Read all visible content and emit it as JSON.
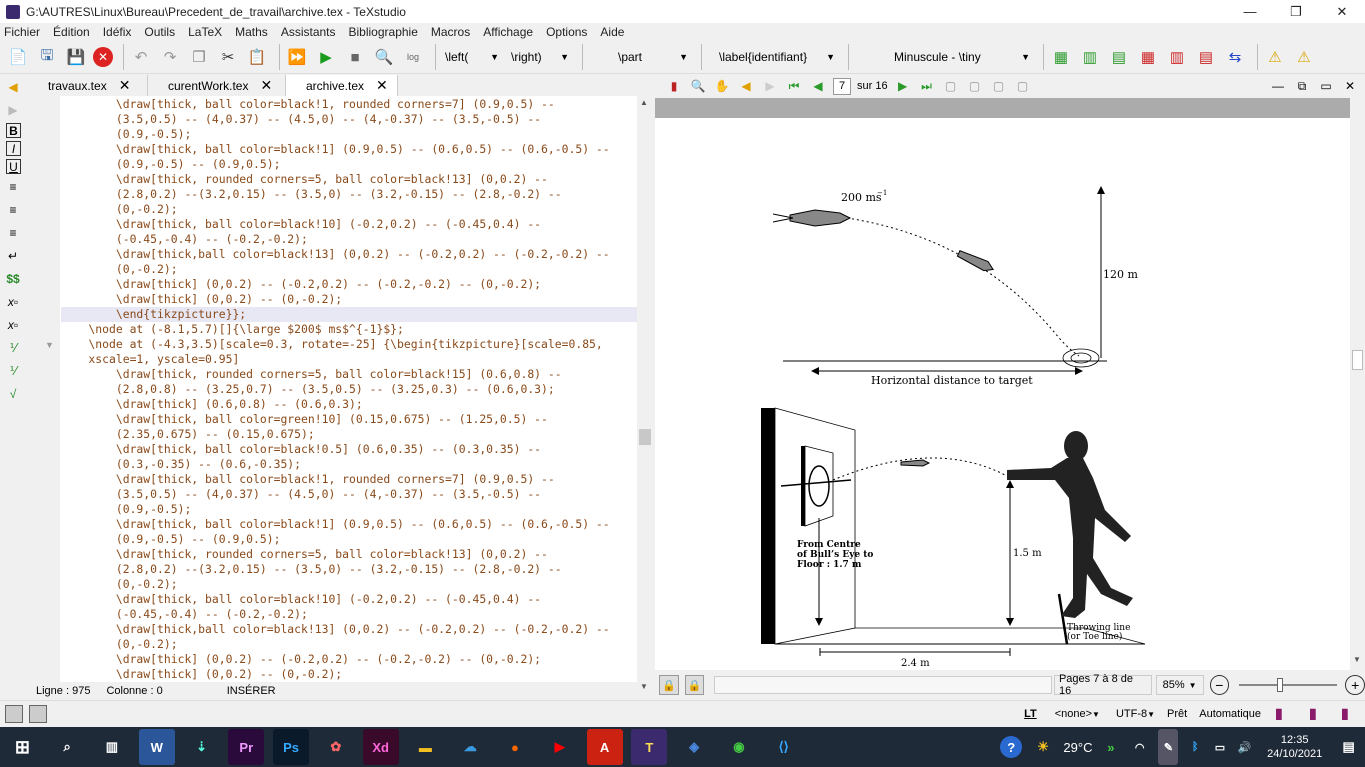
{
  "window": {
    "title": "G:\\AUTRES\\Linux\\Bureau\\Precedent_de_travail\\archive.tex - TeXstudio",
    "min": "—",
    "max": "❐",
    "close": "✕"
  },
  "menu": [
    "Fichier",
    "Édition",
    "Idéfix",
    "Outils",
    "LaTeX",
    "Maths",
    "Assistants",
    "Bibliographie",
    "Macros",
    "Affichage",
    "Options",
    "Aide"
  ],
  "toolbar": {
    "left_combo": "\\left(",
    "right_combo": "\\right)",
    "part_combo": "\\part",
    "label_combo": "\\label{identifiant}",
    "size_combo": "Minuscule - \\tiny"
  },
  "tabs": [
    {
      "label": "travaux.tex",
      "close": "✕"
    },
    {
      "label": "curentWork.tex",
      "close": "✕"
    },
    {
      "label": "archive.tex",
      "close": "✕"
    }
  ],
  "editor": {
    "lines": [
      "        \\draw[thick, ball color=black!1, rounded corners=7] (0.9,0.5) --",
      "        (3.5,0.5) -- (4,0.37) -- (4.5,0) -- (4,-0.37) -- (3.5,-0.5) --",
      "        (0.9,-0.5);",
      "        \\draw[thick, ball color=black!1] (0.9,0.5) -- (0.6,0.5) -- (0.6,-0.5) --",
      "        (0.9,-0.5) -- (0.9,0.5);",
      "        \\draw[thick, rounded corners=5, ball color=black!13] (0,0.2) --",
      "        (2.8,0.2) --(3.2,0.15) -- (3.5,0) -- (3.2,-0.15) -- (2.8,-0.2) --",
      "        (0,-0.2);",
      "        \\draw[thick, ball color=black!10] (-0.2,0.2) -- (-0.45,0.4) --",
      "        (-0.45,-0.4) -- (-0.2,-0.2);",
      "        \\draw[thick,ball color=black!13] (0,0.2) -- (-0.2,0.2) -- (-0.2,-0.2) --",
      "        (0,-0.2);",
      "        \\draw[thick] (0,0.2) -- (-0.2,0.2) -- (-0.2,-0.2) -- (0,-0.2);",
      "        \\draw[thick] (0,0.2) -- (0,-0.2);",
      "        \\end{tikzpicture}};",
      "    \\node at (-8.1,5.7)[]{\\large $200$ ms$^{-1}$};",
      "    \\node at (-4.3,3.5)[scale=0.3, rotate=-25] {\\begin{tikzpicture}[scale=0.85,",
      "    xscale=1, yscale=0.95]",
      "        \\draw[thick, rounded corners=5, ball color=black!15] (0.6,0.8) --",
      "        (2.8,0.8) -- (3.25,0.7) -- (3.5,0.5) -- (3.25,0.3) -- (0.6,0.3);",
      "        \\draw[thick] (0.6,0.8) -- (0.6,0.3);",
      "        \\draw[thick, ball color=green!10] (0.15,0.675) -- (1.25,0.5) --",
      "        (2.35,0.675) -- (0.15,0.675);",
      "        \\draw[thick, ball color=black!0.5] (0.6,0.35) -- (0.3,0.35) --",
      "        (0.3,-0.35) -- (0.6,-0.35);",
      "        \\draw[thick, ball color=black!1, rounded corners=7] (0.9,0.5) --",
      "        (3.5,0.5) -- (4,0.37) -- (4.5,0) -- (4,-0.37) -- (3.5,-0.5) --",
      "        (0.9,-0.5);",
      "        \\draw[thick, ball color=black!1] (0.9,0.5) -- (0.6,0.5) -- (0.6,-0.5) --",
      "        (0.9,-0.5) -- (0.9,0.5);",
      "        \\draw[thick, rounded corners=5, ball color=black!13] (0,0.2) --",
      "        (2.8,0.2) --(3.2,0.15) -- (3.5,0) -- (3.2,-0.15) -- (2.8,-0.2) --",
      "        (0,-0.2);",
      "        \\draw[thick, ball color=black!10] (-0.2,0.2) -- (-0.45,0.4) --",
      "        (-0.45,-0.4) -- (-0.2,-0.2);",
      "        \\draw[thick,ball color=black!13] (0,0.2) -- (-0.2,0.2) -- (-0.2,-0.2) --",
      "        (0,-0.2);",
      "        \\draw[thick] (0,0.2) -- (-0.2,0.2) -- (-0.2,-0.2) -- (0,-0.2);",
      "        \\draw[thick] (0,0.2) -- (0,-0.2);"
    ],
    "highlight_line": 14
  },
  "status": {
    "line": "Ligne : 975",
    "column": "Colonne : 0",
    "mode": "INSÉRER"
  },
  "viewer": {
    "page_current": "7",
    "page_total": "sur 16",
    "pages_label": "Pages 7 à 8 de 16",
    "zoom": "85%",
    "figure": {
      "speed": "200 ms",
      "speed_exp": "−1",
      "height": "120 m",
      "horizontal": "Horizontal distance to target",
      "from_centre_1": "From Centre",
      "from_centre_2": "of Bull’s Eye to",
      "from_centre_3": "Floor : 1.7 m",
      "hand_height": "1.5 m",
      "throwing_1": "Throwing line",
      "throwing_2": "(or Toe line)",
      "distance": "2.4 m"
    }
  },
  "bottom": {
    "lt": "LT",
    "none": "<none>",
    "encoding": "UTF-8",
    "ready": "Prêt",
    "auto": "Automatique"
  },
  "taskbar": {
    "temp": "29°C",
    "time": "12:35",
    "date": "24/10/2021"
  }
}
